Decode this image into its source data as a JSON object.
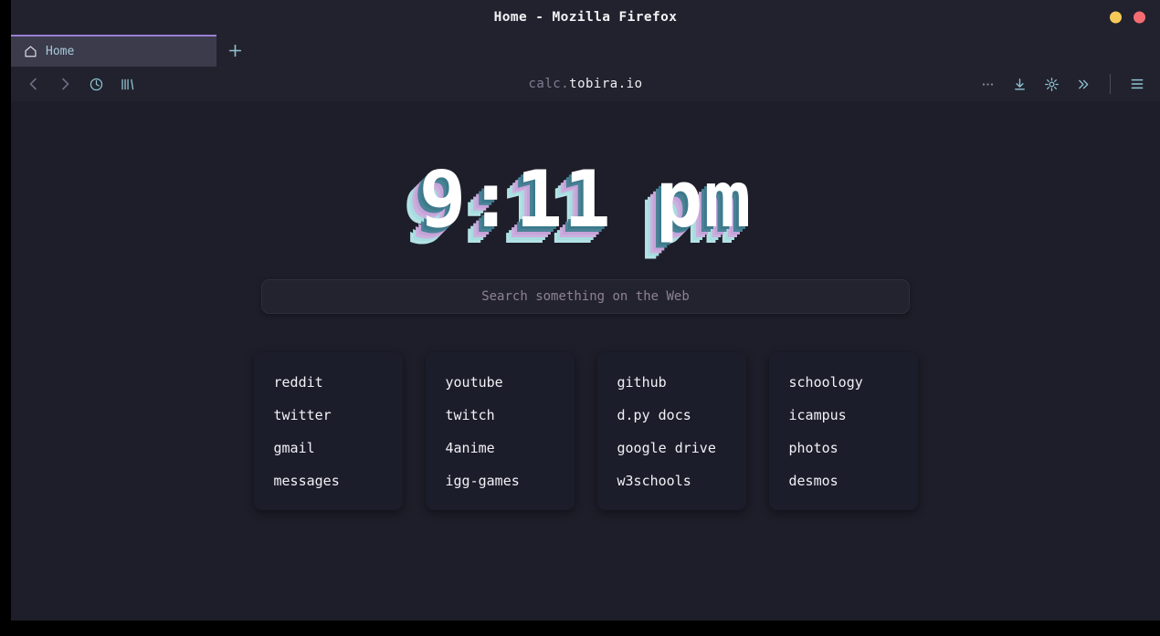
{
  "window": {
    "title": "Home - Mozilla Firefox",
    "buttons": [
      {
        "name": "minimize",
        "color": "#f7ca58"
      },
      {
        "name": "close",
        "color": "#f46c72"
      }
    ]
  },
  "tabbar": {
    "tabs": [
      {
        "label": "Home",
        "icon": "home-icon",
        "active": true
      }
    ],
    "new_tab_label": "+"
  },
  "navbar": {
    "left_icons": [
      "back-icon",
      "forward-icon",
      "history-clock-icon",
      "library-icon"
    ],
    "right_icons": [
      "page-actions-ellipsis-icon",
      "download-icon",
      "gear-icon",
      "overflow-chevrons-icon",
      "hamburger-menu-icon"
    ],
    "url": {
      "prefix": "calc.",
      "domain": "tobira.io",
      "full": "calc.tobira.io"
    }
  },
  "page": {
    "clock": {
      "time": "9:11",
      "meridiem": "pm",
      "shadow_colors": [
        "#3d7a8c",
        "#c5a3d9",
        "#a8dde0"
      ]
    },
    "search": {
      "placeholder": "Search something on the Web",
      "value": ""
    },
    "cards": [
      {
        "name": "social-card",
        "links": [
          "reddit",
          "twitter",
          "gmail",
          "messages"
        ]
      },
      {
        "name": "media-card",
        "links": [
          "youtube",
          "twitch",
          "4anime",
          "igg-games"
        ]
      },
      {
        "name": "dev-card",
        "links": [
          "github",
          "d.py docs",
          "google drive",
          "w3schools"
        ]
      },
      {
        "name": "school-card",
        "links": [
          "schoology",
          "icampus",
          "photos",
          "desmos"
        ]
      }
    ]
  },
  "colors": {
    "page_background": "#1e1e2a",
    "chrome_background": "#22222e",
    "card_background": "#1c1d2a",
    "active_tab_background": "#3b3b4c",
    "tab_accent": "#9b7fd4",
    "icon_accent": "#a8c8d8"
  }
}
